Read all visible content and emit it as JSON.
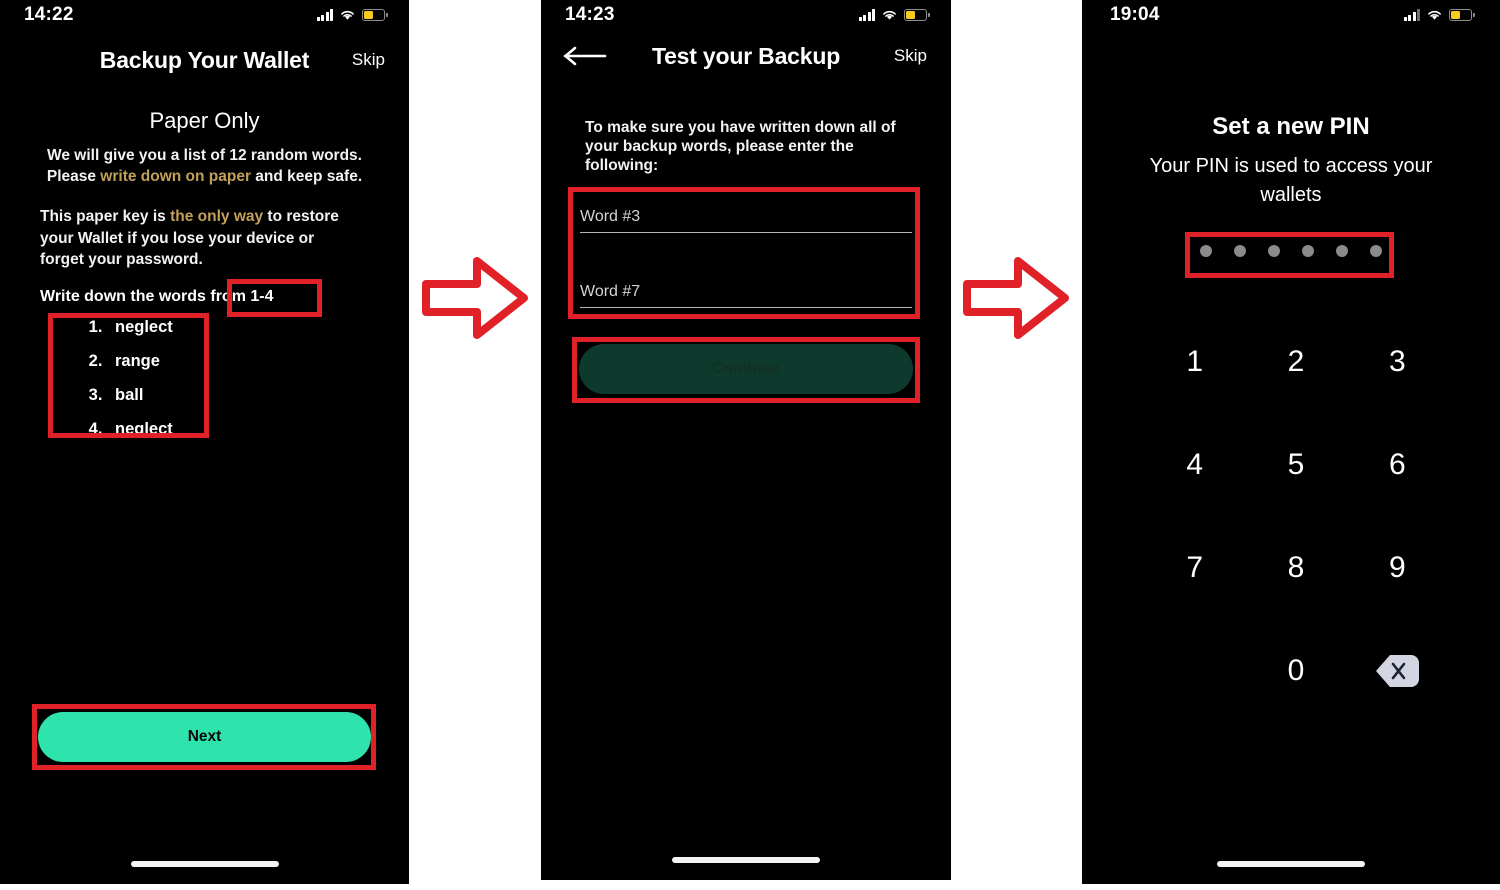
{
  "panels": [
    {
      "id": "backup-your-wallet",
      "status": {
        "time": "14:22",
        "signal_icon": "cellular-bars-icon",
        "wifi_icon": "wifi-icon",
        "battery_icon": "battery-low-power-icon"
      },
      "nav": {
        "title": "Backup Your Wallet",
        "skip_label": "Skip",
        "has_back": false
      },
      "subtitle": "Paper Only",
      "para1_line1": "We will give you a list of 12 random words.",
      "para1_line2_pre": "Please ",
      "para1_line2_accent": "write down on paper",
      "para1_line2_post": " and keep safe.",
      "para2_pre": "This paper key is ",
      "para2_accent": "the only way",
      "para2_post": " to restore your Wallet if you lose your device or forget your password.",
      "writedown_label": "Write down the words from 1-4",
      "words": [
        "neglect",
        "range",
        "ball",
        "neglect"
      ],
      "primary_button": "Next"
    },
    {
      "id": "test-your-backup",
      "status": {
        "time": "14:23",
        "signal_icon": "cellular-bars-icon",
        "wifi_icon": "wifi-icon",
        "battery_icon": "battery-low-power-icon"
      },
      "nav": {
        "title": "Test your Backup",
        "skip_label": "Skip",
        "has_back": true,
        "back_icon": "arrow-left-icon"
      },
      "intro": "To make sure you have written down all of your backup words, please enter the following:",
      "fields": [
        {
          "placeholder": "Word #3",
          "value": ""
        },
        {
          "placeholder": "Word #7",
          "value": ""
        }
      ],
      "primary_button": "Continue"
    },
    {
      "id": "set-a-new-pin",
      "status": {
        "time": "19:04",
        "signal_icon": "cellular-bars-icon",
        "wifi_icon": "wifi-icon",
        "battery_icon": "battery-low-power-icon"
      },
      "title": "Set a new PIN",
      "subtitle": "Your PIN is used to access your wallets",
      "pin_length": 6,
      "pin_filled": 0,
      "keypad": [
        "1",
        "2",
        "3",
        "4",
        "5",
        "6",
        "7",
        "8",
        "9",
        "",
        "0",
        "backspace-icon"
      ]
    }
  ],
  "annotations": {
    "arrow_icon": "arrow-right-outline-icon",
    "highlight_color": "#e02128",
    "arrow_count": 2
  },
  "colors": {
    "screen_background": "#000000",
    "gap_background": "#ffffff",
    "accent_text": "#c2a05a",
    "primary_button": "#2fe3ad",
    "primary_button_disabled": "#0e3a2e",
    "highlight_red": "#e02128",
    "pin_dot": "#8b8b8b",
    "backspace_key": "#d3d6e2",
    "battery_fill": "#f5cb1d"
  }
}
